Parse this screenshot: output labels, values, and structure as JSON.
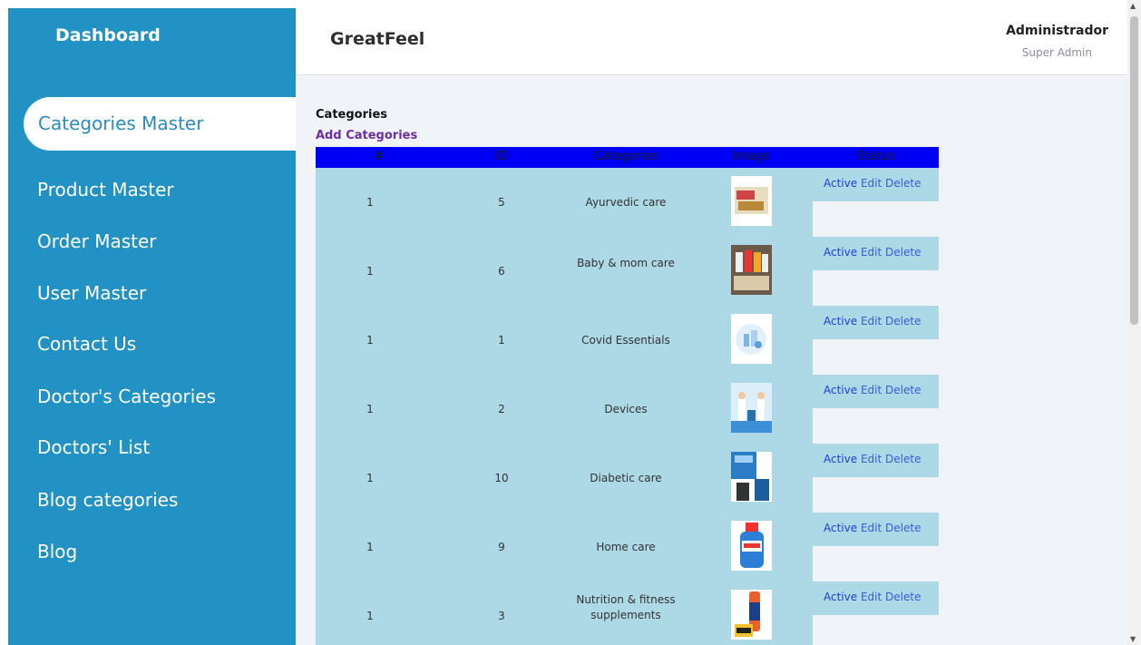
{
  "sidebar": {
    "brand": "Dashboard",
    "items": [
      {
        "label": "Categories Master"
      },
      {
        "label": "Product Master"
      },
      {
        "label": "Order Master"
      },
      {
        "label": "User Master"
      },
      {
        "label": "Contact Us"
      },
      {
        "label": "Doctor's Categories"
      },
      {
        "label": "Doctors' List"
      },
      {
        "label": "Blog categories"
      },
      {
        "label": "Blog"
      }
    ]
  },
  "header": {
    "title": "GreatFeel",
    "user_name": "Administrador",
    "user_role": "Super Admin"
  },
  "main": {
    "heading": "Categories",
    "add_link": "Add Categories",
    "columns": [
      "#",
      "ID",
      "Categories",
      "Image",
      "Status"
    ],
    "actions": {
      "active": "Active",
      "edit": "Edit",
      "delete": "Delete"
    },
    "rows": [
      {
        "num": "1",
        "id": "5",
        "category": "Ayurvedic care"
      },
      {
        "num": "1",
        "id": "6",
        "category": "Baby & mom care"
      },
      {
        "num": "1",
        "id": "1",
        "category": "Covid Essentials"
      },
      {
        "num": "1",
        "id": "2",
        "category": "Devices"
      },
      {
        "num": "1",
        "id": "10",
        "category": "Diabetic care"
      },
      {
        "num": "1",
        "id": "9",
        "category": "Home care"
      },
      {
        "num": "1",
        "id": "3",
        "category": "Nutrition & fitness supplements"
      }
    ]
  },
  "colors": {
    "sidebar_bg": "#2291c4",
    "table_header_bg": "#0000f5",
    "row_bg": "#add8e6",
    "add_link": "#6a2fa6"
  }
}
